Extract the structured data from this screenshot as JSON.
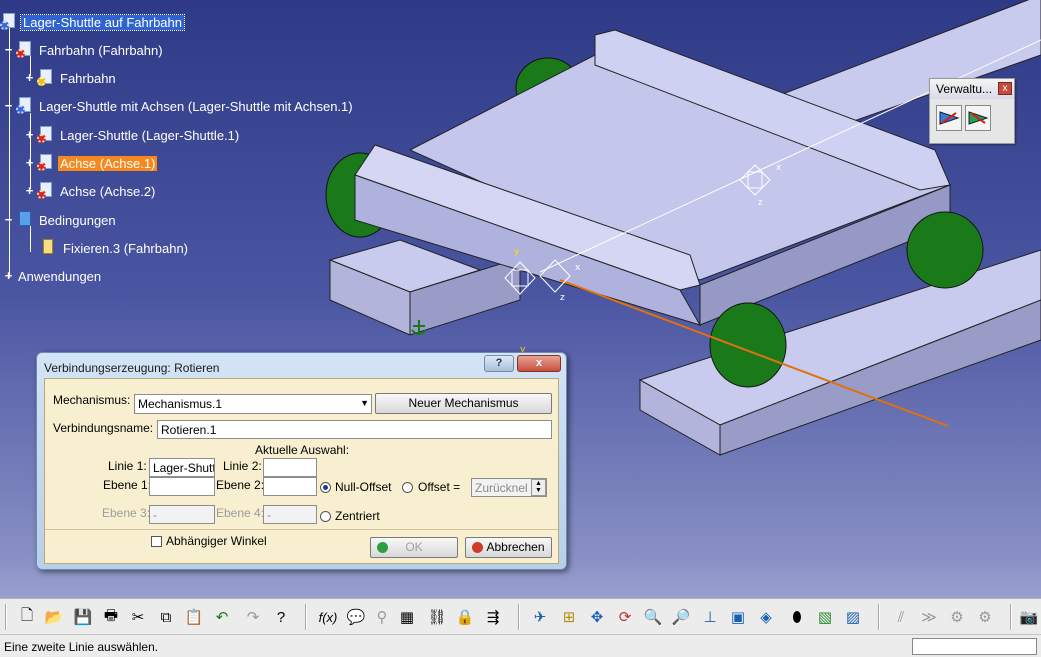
{
  "tree": {
    "root": "Lager-Shuttle auf Fahrbahn",
    "items": [
      {
        "label": "Fahrbahn (Fahrbahn)"
      },
      {
        "label": "Fahrbahn"
      },
      {
        "label": "Lager-Shuttle mit Achsen (Lager-Shuttle mit Achsen.1)"
      },
      {
        "label": "Lager-Shuttle (Lager-Shuttle.1)"
      },
      {
        "label": "Achse (Achse.1)"
      },
      {
        "label": "Achse (Achse.2)"
      },
      {
        "label": "Bedingungen"
      },
      {
        "label": "Fixieren.3 (Fahrbahn)"
      },
      {
        "label": "Anwendungen"
      }
    ]
  },
  "verwaltung": {
    "title": "Verwaltu...",
    "close": "x"
  },
  "axis_labels": {
    "x": "x",
    "y": "y",
    "z": "z"
  },
  "dialog": {
    "title": "Verbindungserzeugung: Rotieren",
    "help": "?",
    "close": "x",
    "mechanismus_label": "Mechanismus:",
    "mechanismus_value": "Mechanismus.1",
    "neuer_mechanismus": "Neuer Mechanismus",
    "verbindungsname_label": "Verbindungsname:",
    "verbindungsname_value": "Rotieren.1",
    "aktuelle_auswahl": "Aktuelle Auswahl:",
    "linie1_label": "Linie 1:",
    "linie1_value": "Lager-Shutt",
    "linie2_label": "Linie 2:",
    "linie2_value": "",
    "ebene1_label": "Ebene 1:",
    "ebene1_value": "",
    "ebene2_label": "Ebene 2:",
    "ebene2_value": "",
    "ebene3_label": "Ebene 3:",
    "ebene3_value": "-",
    "ebene4_label": "Ebene 4:",
    "ebene4_value": "-",
    "null_offset": "Null-Offset",
    "offset": "Offset =",
    "offset_value": "Zurücknel",
    "zentriert": "Zentriert",
    "abhaengiger_winkel": "Abhängiger Winkel",
    "ok": "OK",
    "abbrechen": "Abbrechen"
  },
  "status": {
    "text": "Eine zweite Linie auswählen."
  },
  "colors": {
    "accent_selected": "#f5891f",
    "wheel": "#1a7a1a",
    "axis_line": "#e07010",
    "part": "#c4c6ec"
  }
}
